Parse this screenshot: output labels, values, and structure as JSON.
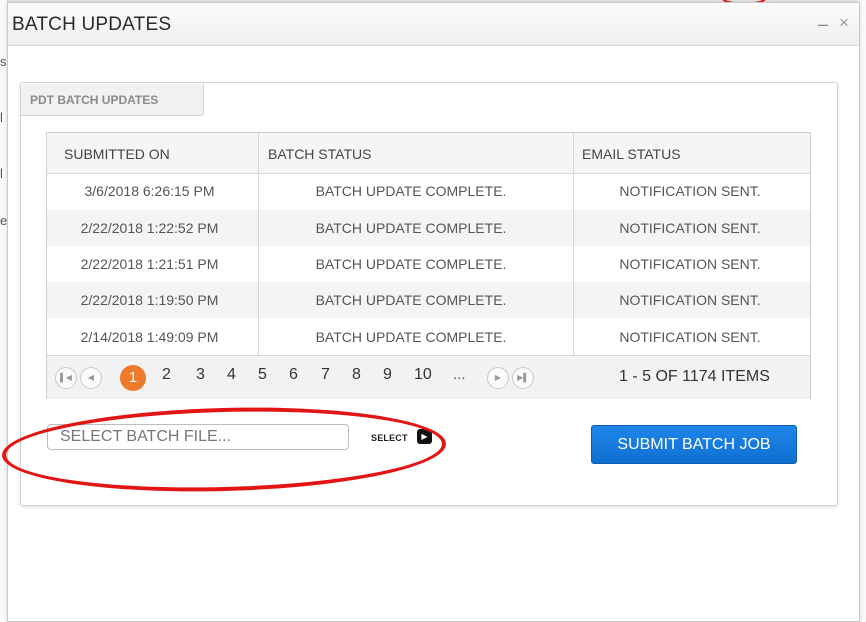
{
  "background": {
    "edge_glyphs": [
      "s",
      "l",
      "l",
      "e"
    ]
  },
  "window": {
    "title": "BATCH UPDATES",
    "minimize_symbol": "–",
    "close_symbol": "×"
  },
  "tab": {
    "label": "PDT BATCH UPDATES"
  },
  "grid": {
    "columns": [
      "SUBMITTED ON",
      "BATCH STATUS",
      "EMAIL STATUS"
    ],
    "rows": [
      [
        "3/6/2018 6:26:15 PM",
        "BATCH UPDATE COMPLETE.",
        "NOTIFICATION SENT."
      ],
      [
        "2/22/2018 1:22:52 PM",
        "BATCH UPDATE COMPLETE.",
        "NOTIFICATION SENT."
      ],
      [
        "2/22/2018 1:21:51 PM",
        "BATCH UPDATE COMPLETE.",
        "NOTIFICATION SENT."
      ],
      [
        "2/22/2018 1:19:50 PM",
        "BATCH UPDATE COMPLETE.",
        "NOTIFICATION SENT."
      ],
      [
        "2/14/2018 1:49:09 PM",
        "BATCH UPDATE COMPLETE.",
        "NOTIFICATION SENT."
      ]
    ]
  },
  "pager": {
    "first_icon": "first-page-icon",
    "prev_icon": "previous-page-icon",
    "next_icon": "next-page-icon",
    "last_icon": "last-page-icon",
    "active_page": "1",
    "pages": [
      "2",
      "3",
      "4",
      "5",
      "6",
      "7",
      "8",
      "9",
      "10"
    ],
    "ellipsis": "...",
    "item_info": "1 - 5 OF 1174 ITEMS"
  },
  "file_select": {
    "placeholder": "SELECT BATCH FILE...",
    "value": "",
    "select_label": "SELECT"
  },
  "submit": {
    "label": "SUBMIT BATCH JOB"
  },
  "colors": {
    "active_page": "#ee7a2c",
    "submit_button": "#1478dc",
    "annotation": "#e21414"
  }
}
